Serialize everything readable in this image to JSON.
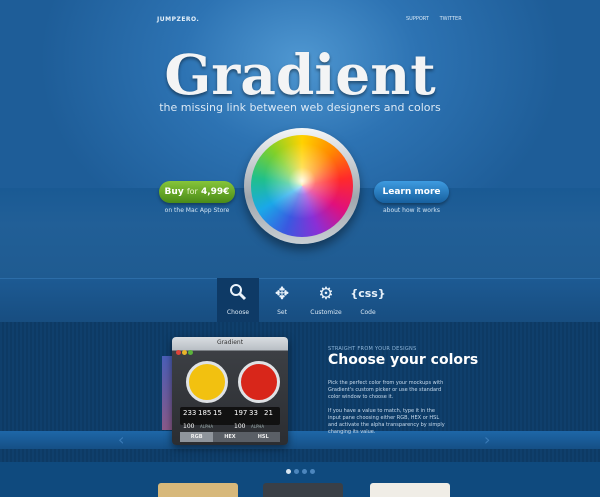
{
  "header": {
    "brand": "JUMPZERO.",
    "links": [
      "SUPPORT",
      "TWITTER"
    ]
  },
  "hero": {
    "title": "Gradient",
    "subtitle": "the missing link between web designers and colors",
    "buy": {
      "label": "Buy",
      "for": "for",
      "price": "4,99€",
      "caption": "on the Mac App Store"
    },
    "more": {
      "label": "Learn more",
      "caption": "about how it works"
    }
  },
  "nav": {
    "items": [
      {
        "icon": "search-icon",
        "label": "Choose",
        "active": true
      },
      {
        "icon": "move-icon",
        "label": "Set"
      },
      {
        "icon": "gears-icon",
        "label": "Customize"
      },
      {
        "icon": "css-icon",
        "label": "Code"
      }
    ],
    "css_glyph": "{css}"
  },
  "app": {
    "window_title": "Gradient",
    "left": {
      "r": "233",
      "g": "185",
      "b": "15",
      "alpha": "100",
      "alpha_label": "ALPHA"
    },
    "right": {
      "r": "197",
      "g": "33",
      "b": "21",
      "alpha": "100",
      "alpha_label": "ALPHA"
    },
    "tabs": [
      "RGB",
      "HEX",
      "HSL"
    ],
    "active_tab": "RGB"
  },
  "feature": {
    "kicker": "STRAIGHT FROM YOUR DESIGNS",
    "heading": "Choose your colors",
    "para1": "Pick the perfect color from your mockups with Gradient's custom picker or use the standard color window to choose it.",
    "para2": "If you have a value to match, type it in the input pane choosing either RGB, HEX or HSL and activate the alpha transparency by simply changing its value."
  },
  "slider": {
    "count": 4,
    "active": 0
  },
  "colors": {
    "accent_green": "#6bb02a",
    "accent_blue": "#2f86cf",
    "bg": "#0f4a7e"
  }
}
